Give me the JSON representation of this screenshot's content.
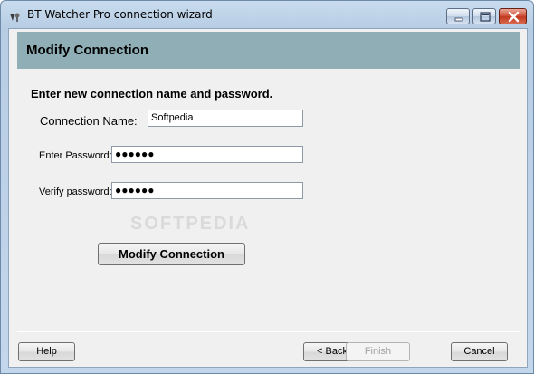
{
  "window": {
    "title": "BT Watcher Pro connection wizard"
  },
  "header": {
    "title": "Modify Connection"
  },
  "form": {
    "instruction": "Enter new connection name and password.",
    "name_label": "Connection Name:",
    "name_value": "Softpedia",
    "password_label": "Enter Password:",
    "password_value": "●●●●●●",
    "verify_label": "Verify password:",
    "verify_value": "●●●●●●",
    "modify_button": "Modify Connection"
  },
  "watermark": "SOFTPEDIA",
  "footer": {
    "help": "Help",
    "back": "< Back",
    "finish": "Finish",
    "cancel": "Cancel"
  },
  "colors": {
    "header_band": "#8faeb5",
    "titlebar": "#c9dcee"
  },
  "icons": {
    "app": "app-icon",
    "minimize": "minimize-icon",
    "maximize": "maximize-icon",
    "close": "close-icon"
  }
}
